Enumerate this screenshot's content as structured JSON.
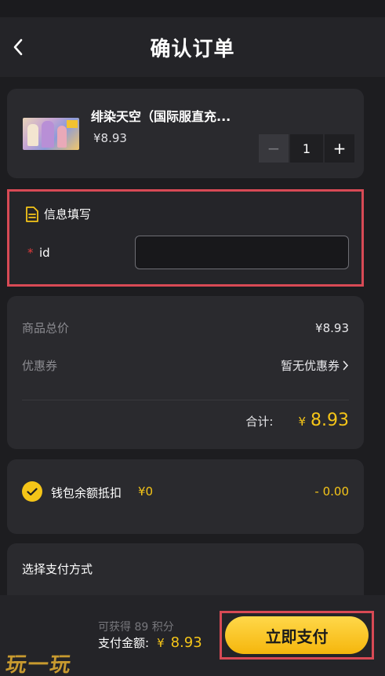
{
  "header": {
    "title": "确认订单",
    "back_icon": "chevron-left-icon"
  },
  "product": {
    "name": "绯染天空（国际服直充...",
    "price": "¥8.93",
    "quantity": "1",
    "minus_label": "−",
    "plus_label": "+"
  },
  "info": {
    "title": "信息填写",
    "icon": "document-icon",
    "required_mark": "*",
    "id_label": "id",
    "id_value": "",
    "id_placeholder": ""
  },
  "summary": {
    "goods_total_label": "商品总价",
    "goods_total_value": "¥8.93",
    "coupon_label": "优惠券",
    "coupon_value": "暂无优惠券",
    "total_label": "合计:",
    "total_currency": "¥",
    "total_value": "8.93"
  },
  "wallet": {
    "label": "钱包余额抵扣",
    "balance": "¥0",
    "deduct": "- 0.00",
    "checked": true
  },
  "payment_method": {
    "title": "选择支付方式"
  },
  "bottom": {
    "points_text": "可获得 89 积分",
    "pay_label": "支付金额:",
    "pay_currency": "¥",
    "pay_value": "8.93",
    "pay_button": "立即支付"
  },
  "watermark": "玩一玩",
  "colors": {
    "accent": "#f5c518",
    "highlight_border": "#d84a55",
    "background": "#1d1d20",
    "card": "#2a2a2e"
  }
}
